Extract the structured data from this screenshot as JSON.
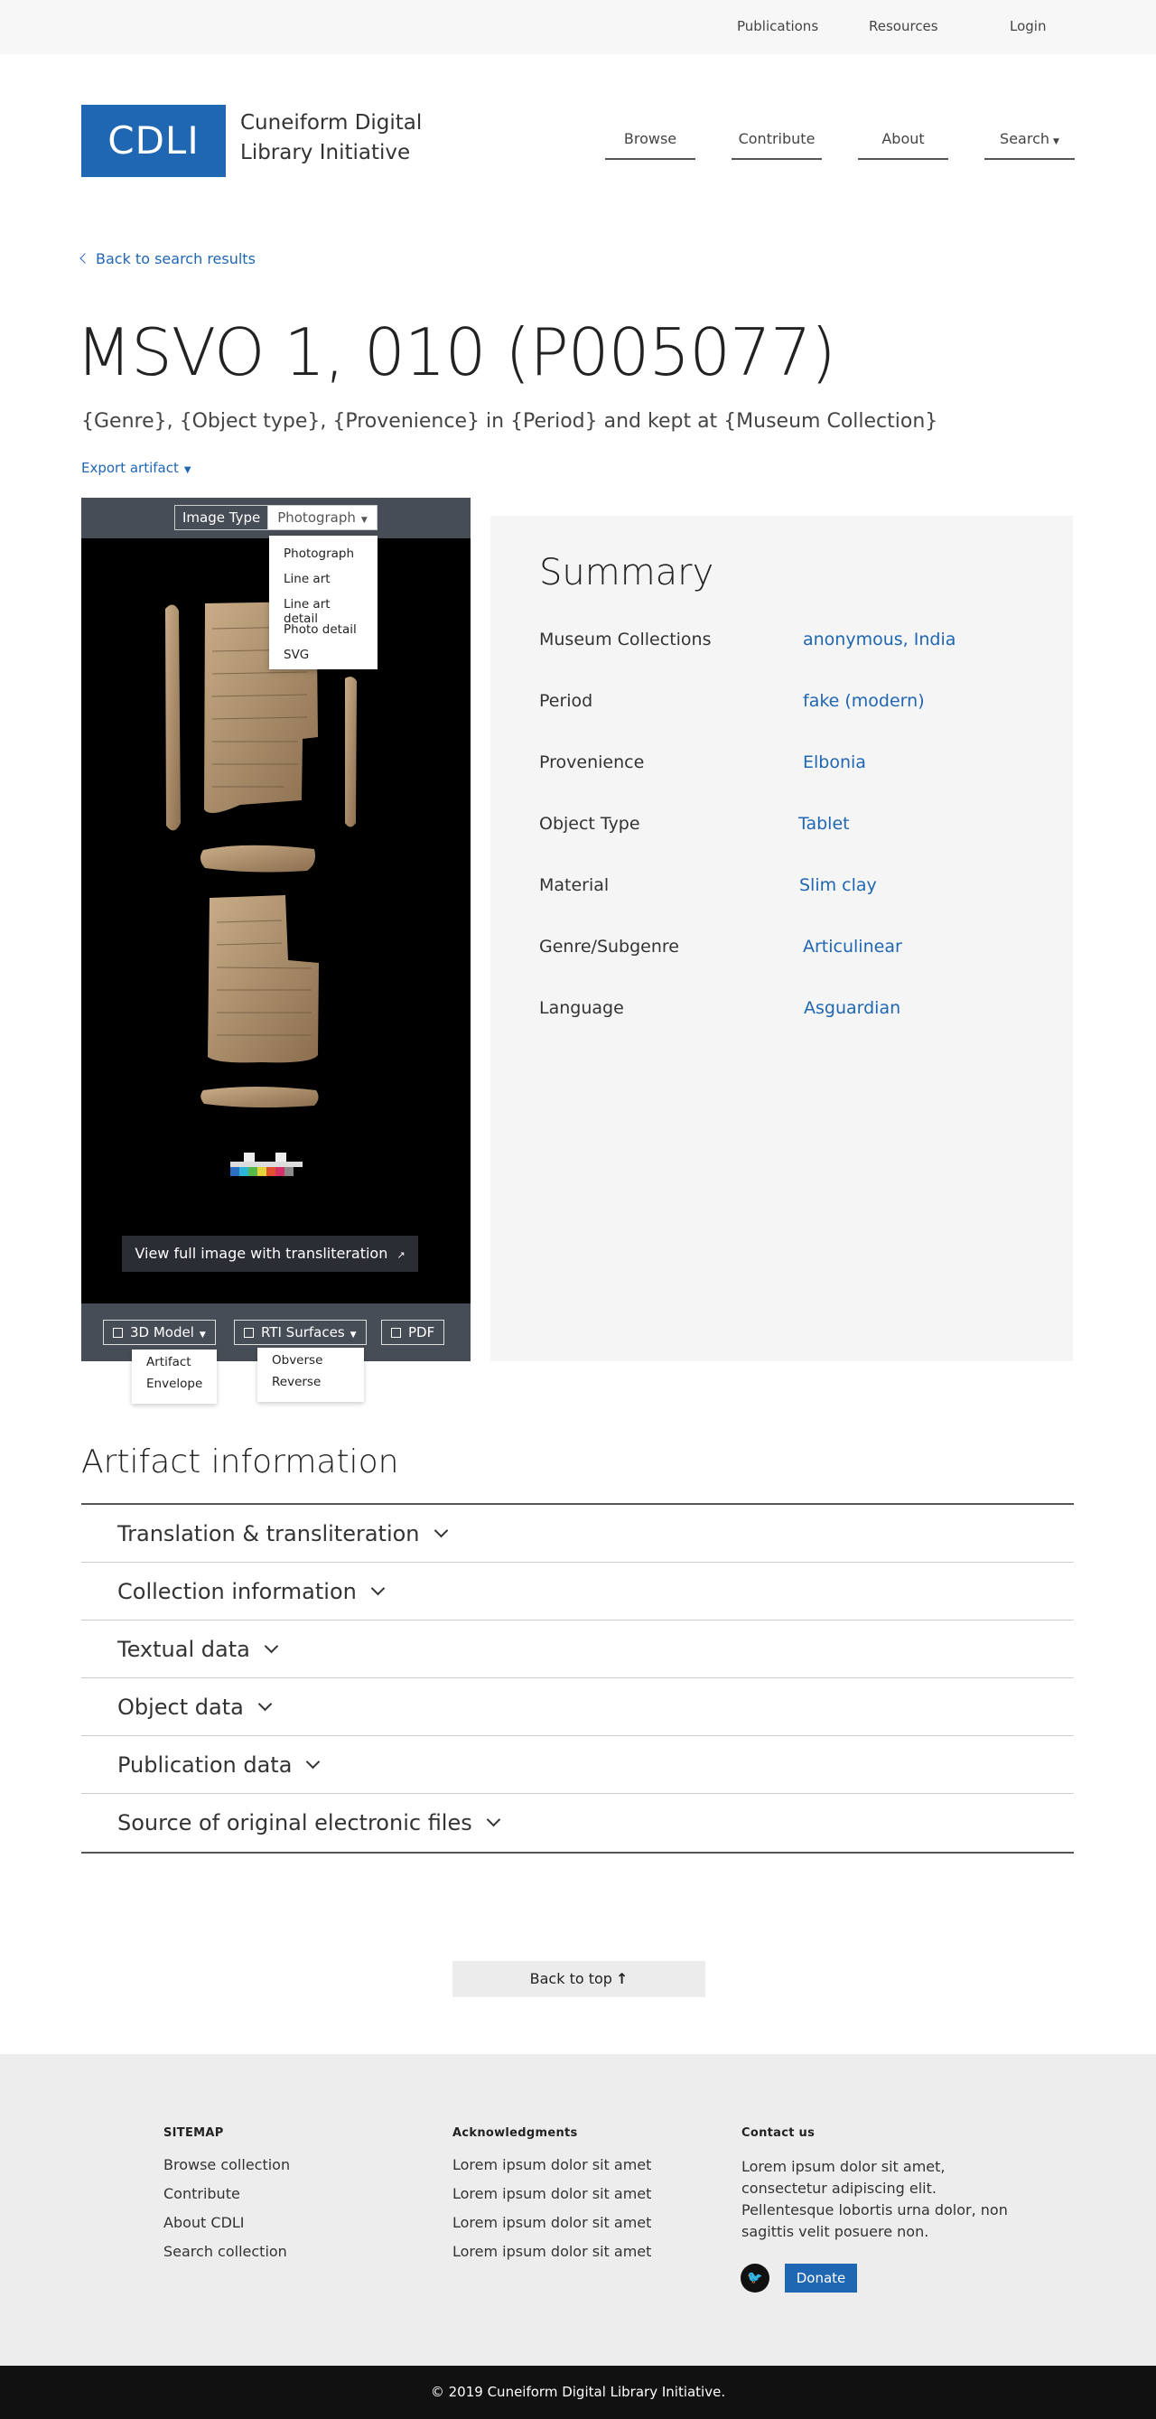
{
  "topbar": {
    "publications": "Publications",
    "resources": "Resources",
    "login": "Login"
  },
  "header": {
    "logo": "CDLI",
    "site_name_line1": "Cuneiform Digital",
    "site_name_line2": "Library Initiative",
    "nav": {
      "browse": "Browse",
      "contribute": "Contribute",
      "about": "About",
      "search": "Search"
    }
  },
  "back_link": "Back to search results",
  "artifact": {
    "title": "MSVO 1, 010 (P005077)",
    "subtitle": "{Genre}, {Object type}, {Provenience} in {Period} and kept at {Museum Collection}",
    "export": "Export artifact"
  },
  "viewer": {
    "image_type_label": "Image Type",
    "image_type_selected": "Photograph",
    "image_type_options": [
      "Photograph",
      "Line art",
      "Line art detail",
      "Photo detail",
      "SVG"
    ],
    "view_full": "View full image with transliteration",
    "model_button": "3D Model",
    "model_options": [
      "Artifact",
      "Envelope"
    ],
    "rti_button": "RTI Surfaces",
    "rti_options": [
      "Obverse",
      "Reverse"
    ],
    "pdf_button": "PDF"
  },
  "summary": {
    "title": "Summary",
    "rows": [
      {
        "key": "Museum Collections",
        "value": "anonymous, India"
      },
      {
        "key": "Period",
        "value": "fake (modern)"
      },
      {
        "key": "Provenience",
        "value": "Elbonia"
      },
      {
        "key": "Object Type",
        "value": "Tablet"
      },
      {
        "key": "Material",
        "value": "Slim clay"
      },
      {
        "key": "Genre/Subgenre",
        "value": "Articulinear"
      },
      {
        "key": "Language",
        "value": "Asguardian"
      }
    ]
  },
  "artifact_info": {
    "title": "Artifact information",
    "sections": [
      "Translation & transliteration",
      "Collection information",
      "Textual data",
      "Object data",
      "Publication data",
      "Source of original electronic files"
    ]
  },
  "back_to_top": "Back to top",
  "footer": {
    "sitemap": {
      "title": "SITEMAP",
      "items": [
        "Browse collection",
        "Contribute",
        "About CDLI",
        "Search collection"
      ]
    },
    "acknowledgments": {
      "title": "Acknowledgments",
      "items": [
        "Lorem ipsum dolor sit amet",
        "Lorem ipsum dolor sit amet",
        "Lorem ipsum dolor sit amet",
        "Lorem ipsum dolor sit amet"
      ]
    },
    "contact": {
      "title": "Contact us",
      "text": "Lorem ipsum dolor sit amet, consectetur adipiscing elit. Pellentesque lobortis urna dolor, non sagittis velit posuere non."
    },
    "donate": "Donate",
    "copyright": "© 2019 Cuneiform Digital Library Initiative."
  },
  "colors": {
    "brand_blue": "#1f66b3",
    "viewer_bar": "#474d56",
    "summary_bg": "#f5f5f5",
    "footer_bg": "#ededed"
  }
}
